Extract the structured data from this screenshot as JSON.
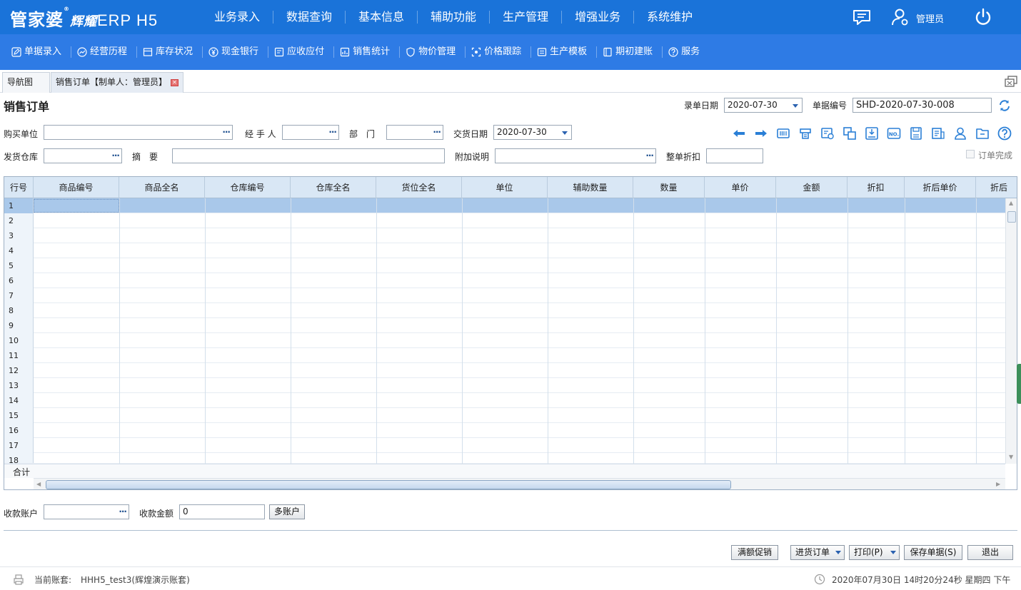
{
  "brand": {
    "name": "管家婆",
    "mark": "®",
    "product": "辉耀",
    "suffix": "ERP H5"
  },
  "main_nav": [
    "业务录入",
    "数据查询",
    "基本信息",
    "辅助功能",
    "生产管理",
    "增强业务",
    "系统维护"
  ],
  "user": {
    "name": "管理员"
  },
  "sub_nav": [
    {
      "label": "单据录入",
      "icon": "pencil-icon"
    },
    {
      "label": "经营历程",
      "icon": "trend-icon"
    },
    {
      "label": "库存状况",
      "icon": "stock-icon"
    },
    {
      "label": "现金银行",
      "icon": "yuan-icon"
    },
    {
      "label": "应收应付",
      "icon": "ledger-icon"
    },
    {
      "label": "销售统计",
      "icon": "chart-icon"
    },
    {
      "label": "物价管理",
      "icon": "shield-icon"
    },
    {
      "label": "价格跟踪",
      "icon": "track-icon"
    },
    {
      "label": "生产模板",
      "icon": "template-icon"
    },
    {
      "label": "期初建账",
      "icon": "book-icon"
    },
    {
      "label": "服务",
      "icon": "question-icon"
    }
  ],
  "tabs": {
    "nav": "导航图",
    "active": "销售订单【制单人：管理员】"
  },
  "form": {
    "title": "销售订单",
    "entry_date_label": "录单日期",
    "entry_date": "2020-07-30",
    "doc_no_label": "单据编号",
    "doc_no": "SHD-2020-07-30-008",
    "buyer_label": "购买单位",
    "buyer": "",
    "handler_label": "经 手 人",
    "handler": "",
    "dept_label": "部　门",
    "dept": "",
    "delivery_date_label": "交货日期",
    "delivery_date": "2020-07-30",
    "warehouse_label": "发货仓库",
    "warehouse": "",
    "summary_label": "摘　要",
    "summary": "",
    "note_label": "附加说明",
    "note": "",
    "discount_label": "整单折扣",
    "discount": "",
    "complete_label": "订单完成",
    "dots": "···"
  },
  "toolbar_icons": [
    "arrow-left-icon",
    "arrow-right-icon",
    "barcode-icon",
    "print-config-icon",
    "image-icon",
    "copy-icon",
    "import-icon",
    "serial-no-icon",
    "save-template-icon",
    "stock-query-icon",
    "user-icon",
    "folder-icon",
    "help-icon"
  ],
  "table": {
    "columns": [
      "行号",
      "商品编号",
      "商品全名",
      "仓库编号",
      "仓库全名",
      "货位全名",
      "单位",
      "辅助数量",
      "数量",
      "单价",
      "金额",
      "折扣",
      "折后单价",
      "折后"
    ],
    "rows": [
      "1",
      "2",
      "3",
      "4",
      "5",
      "6",
      "7",
      "8",
      "9",
      "10",
      "11",
      "12",
      "13",
      "14",
      "15",
      "16",
      "17",
      "18"
    ],
    "total_label": "合计",
    "selected_row": 1
  },
  "payment": {
    "account_label": "收款账户",
    "account": "",
    "amount_label": "收款金额",
    "amount": "0",
    "multi_button": "多账户"
  },
  "actions": {
    "promo": "满额促销",
    "purchase_order": "进货订单",
    "print": "打印(P)",
    "save": "保存单据(S)",
    "exit": "退出"
  },
  "footer": {
    "account_label": "当前账套:",
    "account_name": "HHH5_test3(辉煌演示账套)",
    "datetime": "2020年07月30日 14时20分24秒 星期四 下午"
  },
  "colors": {
    "top_bar": "#1a73d9",
    "sub_bar": "#2e7be5",
    "header_row": "#d9e7f5",
    "selected_row": "#a9c8ea",
    "icon_blue": "#2a7fd6"
  }
}
